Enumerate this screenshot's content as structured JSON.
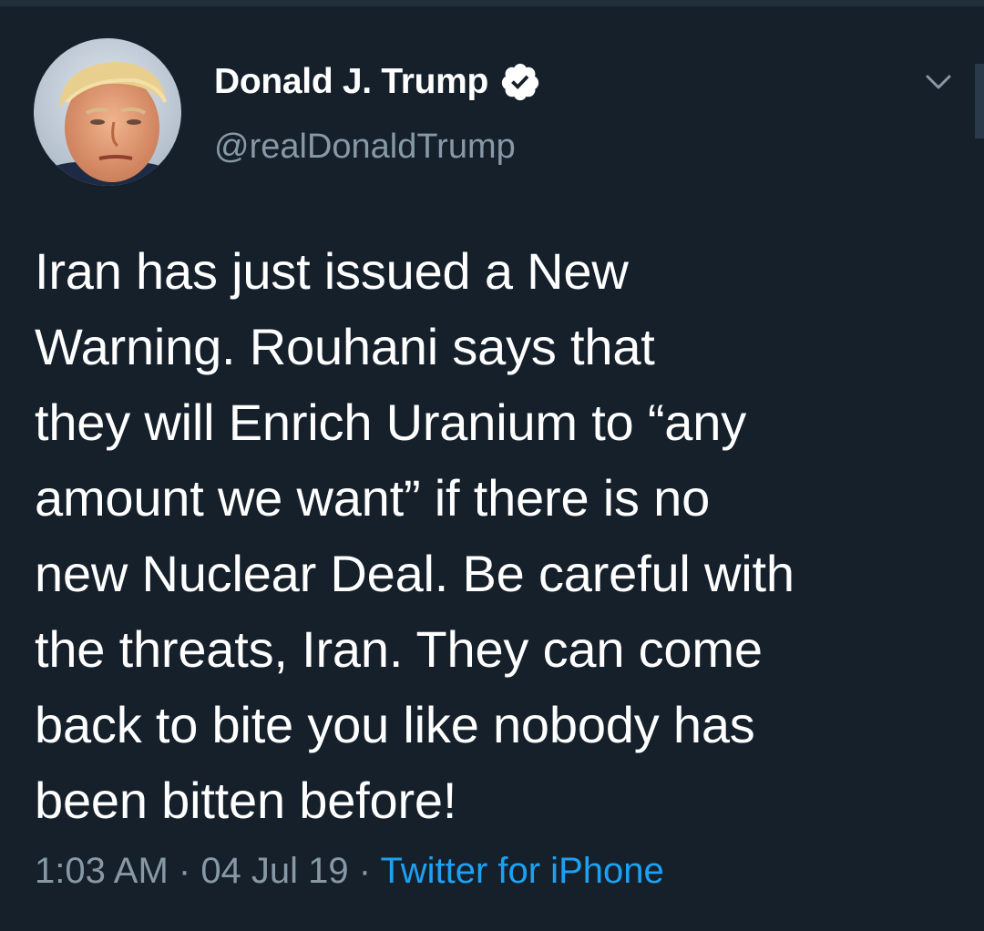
{
  "tweet": {
    "display_name": "Donald J. Trump",
    "handle": "@realDonaldTrump",
    "text": "Iran has just issued a New\nWarning. Rouhani says that\nthey will Enrich Uranium to “any\namount we want” if there is no\nnew Nuclear Deal. Be careful with\nthe threats, Iran. They can come\nback to bite you like nobody has\nbeen bitten before!",
    "time": "1:03 AM",
    "separator": " · ",
    "date": "04 Jul 19",
    "source": "Twitter for iPhone"
  },
  "icons": {
    "verified": "verified-badge-icon",
    "menu": "chevron-down-icon"
  },
  "colors": {
    "background": "#15202b",
    "primary_text": "#ffffff",
    "secondary_text": "#8899a6",
    "accent": "#1da1f2"
  }
}
